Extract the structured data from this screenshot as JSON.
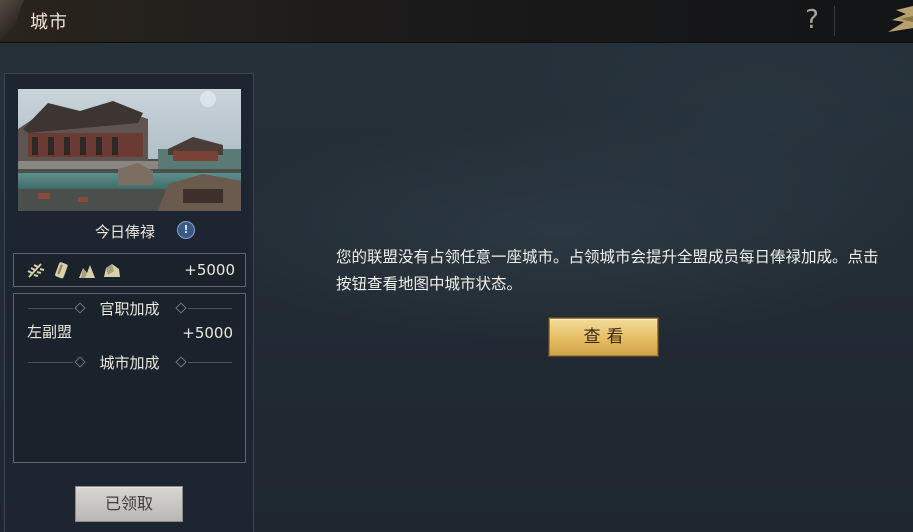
{
  "header": {
    "title": "城市",
    "help_glyph": "?"
  },
  "panel": {
    "daily_label": "今日俸禄",
    "info_glyph": "!",
    "resources": {
      "icons": [
        "wheat-icon",
        "wood-icon",
        "stone-icon",
        "ore-icon"
      ],
      "amount": "+5000"
    },
    "bonus": {
      "official_section": "官职加成",
      "rank_label": "左副盟",
      "rank_value": "+5000",
      "city_section": "城市加成"
    },
    "claimed_button": "已领取"
  },
  "main": {
    "message": "您的联盟没有占领任意一座城市。占领城市会提升全盟成员每日俸禄加成。点击按钮查看地图中城市状态。",
    "view_button": "查看"
  },
  "colors": {
    "accent_gold": "#e5bd63",
    "info_blue": "#3a5a86",
    "panel_bg": "#1d2630"
  }
}
